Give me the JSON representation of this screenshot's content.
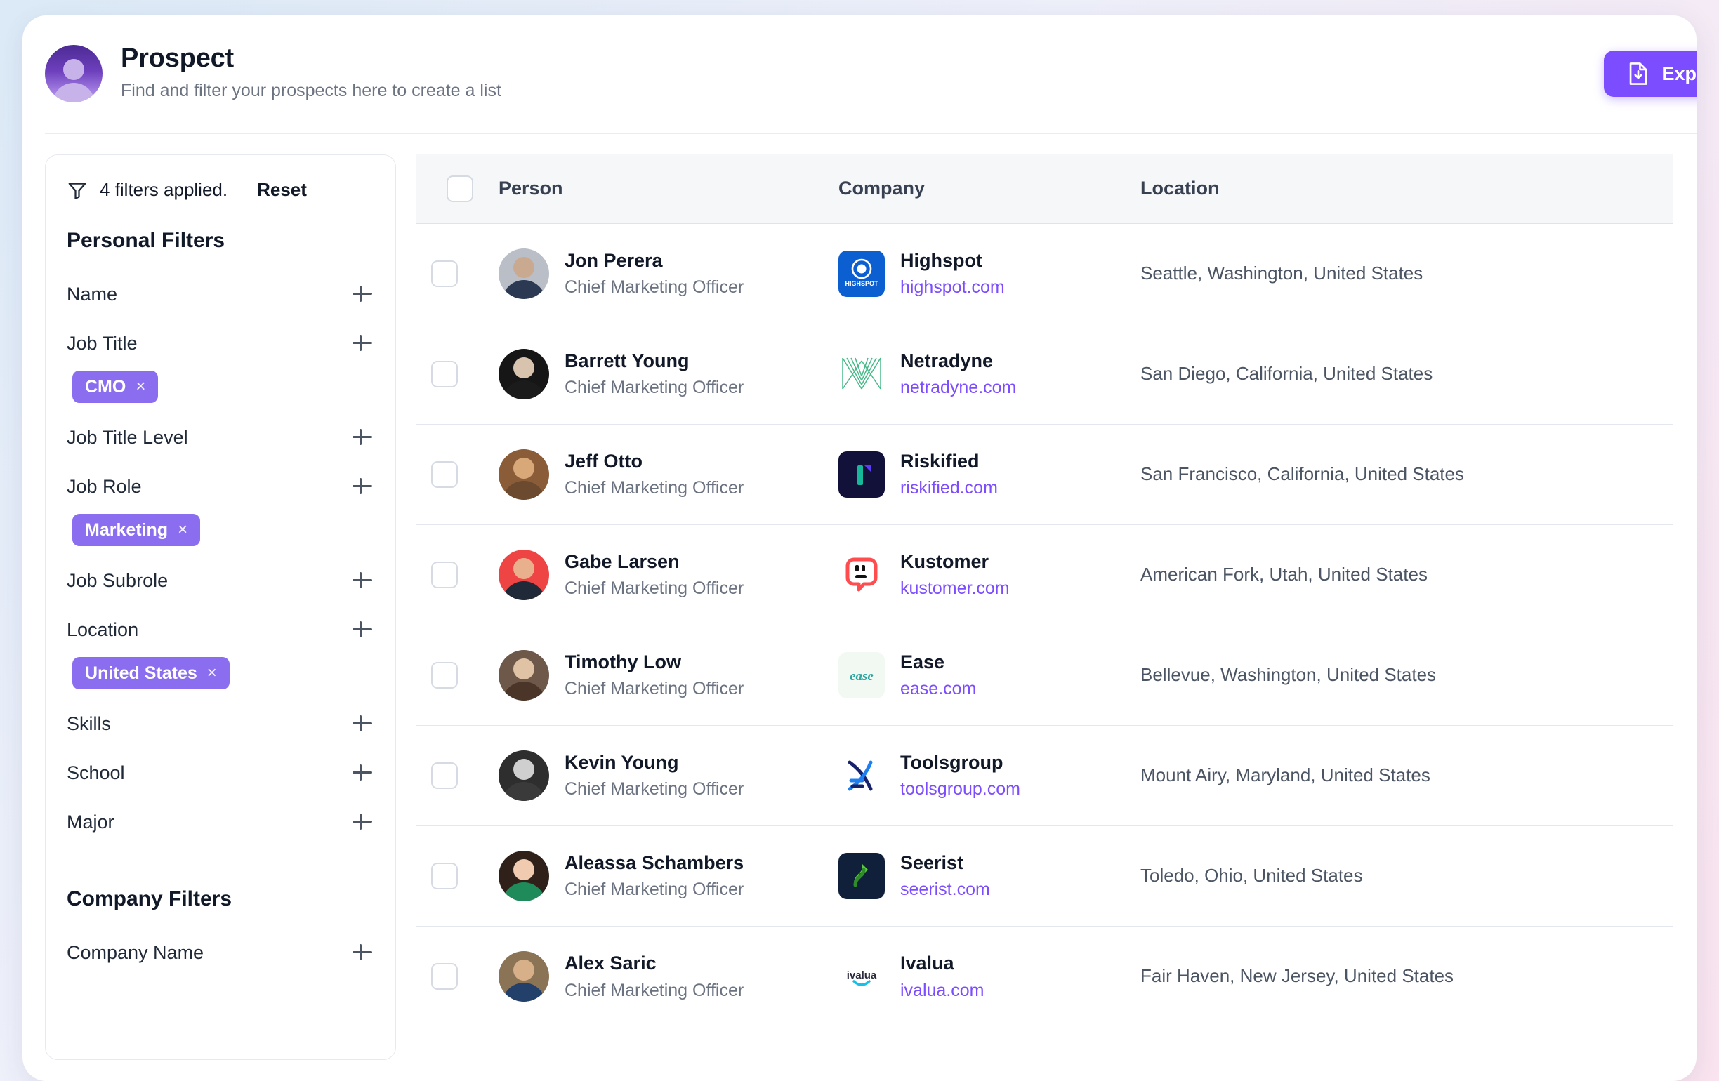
{
  "header": {
    "title": "Prospect",
    "subtitle": "Find and filter your prospects here to create a list",
    "export_label": "Export",
    "avatar_icon": "user-avatar-icon",
    "export_icon": "file-download-icon"
  },
  "filters": {
    "funnel_icon": "funnel-icon",
    "applied_text": "4 filters applied.",
    "reset_label": "Reset",
    "personal_section": "Personal Filters",
    "company_section": "Company Filters",
    "personal_items": [
      {
        "label": "Name",
        "chip": null
      },
      {
        "label": "Job Title",
        "chip": "CMO"
      },
      {
        "label": "Job Title Level",
        "chip": null
      },
      {
        "label": "Job Role",
        "chip": "Marketing"
      },
      {
        "label": "Job Subrole",
        "chip": null
      },
      {
        "label": "Location",
        "chip": "United States"
      },
      {
        "label": "Skills",
        "chip": null
      },
      {
        "label": "School",
        "chip": null
      },
      {
        "label": "Major",
        "chip": null
      }
    ],
    "company_items": [
      {
        "label": "Company Name",
        "chip": null
      }
    ],
    "chip_remove_glyph": "×",
    "add_glyph": "+"
  },
  "table": {
    "columns": [
      "Person",
      "Company",
      "Location"
    ],
    "rows": [
      {
        "name": "Jon Perera",
        "role": "Chief Marketing Officer",
        "company": "Highspot",
        "domain": "highspot.com",
        "location": "Seattle, Washington, United States",
        "logo": "highspot-logo",
        "avatar_colors": [
          "#c9a98f",
          "#2b3a52",
          "#b9bec7"
        ]
      },
      {
        "name": "Barrett Young",
        "role": "Chief Marketing Officer",
        "company": "Netradyne",
        "domain": "netradyne.com",
        "location": "San Diego, California, United States",
        "logo": "netradyne-logo",
        "avatar_colors": [
          "#d8c3ae",
          "#1b1b1b",
          "#161616"
        ]
      },
      {
        "name": "Jeff Otto",
        "role": "Chief Marketing Officer",
        "company": "Riskified",
        "domain": "riskified.com",
        "location": "San Francisco, California, United States",
        "logo": "riskified-logo",
        "avatar_colors": [
          "#d9a879",
          "#6b4a2f",
          "#8a5c38"
        ]
      },
      {
        "name": "Gabe Larsen",
        "role": "Chief Marketing Officer",
        "company": "Kustomer",
        "domain": "kustomer.com",
        "location": "American Fork, Utah, United States",
        "logo": "kustomer-logo",
        "avatar_colors": [
          "#e8b08d",
          "#1f2937",
          "#ef4444"
        ]
      },
      {
        "name": "Timothy Low",
        "role": "Chief Marketing Officer",
        "company": "Ease",
        "domain": "ease.com",
        "location": "Bellevue, Washington, United States",
        "logo": "ease-logo",
        "avatar_colors": [
          "#e0c3a4",
          "#4a3528",
          "#6d584a"
        ]
      },
      {
        "name": "Kevin Young",
        "role": "Chief Marketing Officer",
        "company": "Toolsgroup",
        "domain": "toolsgroup.com",
        "location": "Mount Airy, Maryland, United States",
        "logo": "toolsgroup-logo",
        "avatar_colors": [
          "#cfcfcf",
          "#3a3a3a",
          "#2e2e2e"
        ]
      },
      {
        "name": "Aleassa Schambers",
        "role": "Chief Marketing Officer",
        "company": "Seerist",
        "domain": "seerist.com",
        "location": "Toledo, Ohio, United States",
        "logo": "seerist-logo",
        "avatar_colors": [
          "#f0cbb0",
          "#1f8a5a",
          "#2f2119"
        ]
      },
      {
        "name": "Alex Saric",
        "role": "Chief Marketing Officer",
        "company": "Ivalua",
        "domain": "ivalua.com",
        "location": "Fair Haven, New Jersey, United States",
        "logo": "ivalua-logo",
        "avatar_colors": [
          "#d7b08a",
          "#23406b",
          "#8b7356"
        ]
      }
    ]
  },
  "colors": {
    "accent": "#7c4dff",
    "chip": "#8b6ef0",
    "link": "#7c4dff",
    "header_bg": "#f6f7f9"
  }
}
